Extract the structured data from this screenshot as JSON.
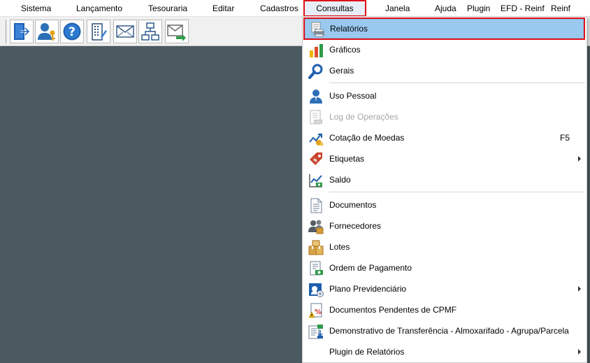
{
  "menubar": {
    "items": [
      "Sistema",
      "Lançamento",
      "Tesouraria",
      "Editar",
      "Cadastros",
      "Consultas",
      "Janela",
      "Ajuda",
      "Plugin",
      "EFD - Reinf",
      "Reinf"
    ],
    "active": "Consultas"
  },
  "toolbar": {
    "buttons": [
      "exit-icon",
      "user-key-icon",
      "help-icon",
      "building-icon",
      "mail-icon",
      "network-icon",
      "mail-send-icon"
    ]
  },
  "dropdown": {
    "items": [
      {
        "label": "Relatórios",
        "icon": "report-printer-icon",
        "highlighted": true
      },
      {
        "label": "Gráficos",
        "icon": "bar-chart-icon"
      },
      {
        "label": "Gerais",
        "icon": "magnifier-icon"
      },
      {
        "label": "Uso Pessoal",
        "icon": "person-icon"
      },
      {
        "label": "Log de Operações",
        "icon": "log-document-icon",
        "disabled": true
      },
      {
        "label": "Cotação de Moedas",
        "icon": "currency-chart-icon",
        "shortcut": "F5"
      },
      {
        "label": "Etiquetas",
        "icon": "price-tag-icon",
        "submenu": true
      },
      {
        "label": "Saldo",
        "icon": "balance-chart-icon"
      },
      {
        "label": "Documentos",
        "icon": "document-icon"
      },
      {
        "label": "Fornecedores",
        "icon": "suppliers-icon"
      },
      {
        "label": "Lotes",
        "icon": "boxes-icon"
      },
      {
        "label": "Ordem de Pagamento",
        "icon": "payment-order-icon"
      },
      {
        "label": "Plano Previdenciário",
        "icon": "pension-plan-icon",
        "submenu": true
      },
      {
        "label": "Documentos Pendentes de CPMF",
        "icon": "pending-document-icon"
      },
      {
        "label": "Demonstrativo de Transferência - Almoxarifado - Agrupa/Parcela",
        "icon": "transfer-report-icon"
      },
      {
        "label": "Plugin de Relatórios",
        "icon": "",
        "submenu": true
      }
    ]
  }
}
